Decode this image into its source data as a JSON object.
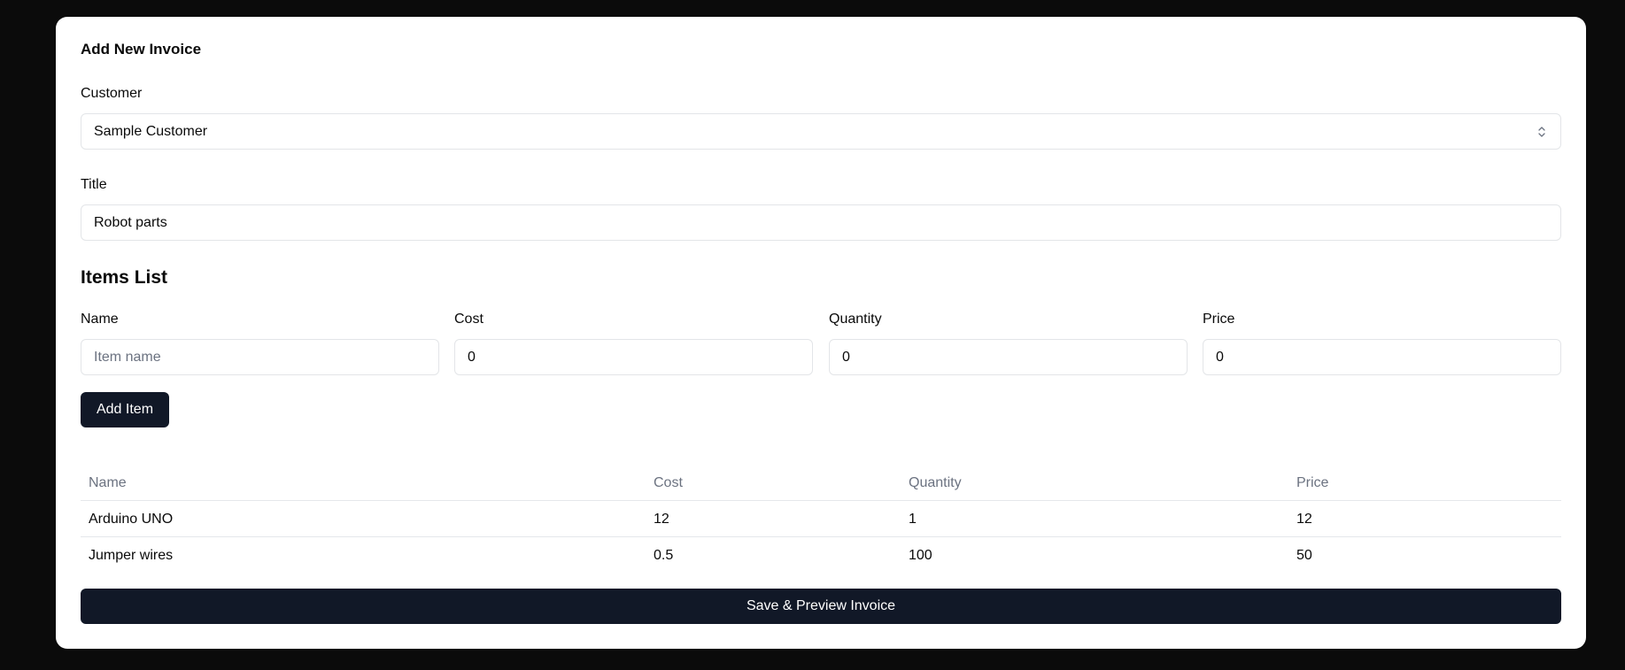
{
  "form": {
    "title": "Add New Invoice",
    "customer_label": "Customer",
    "customer_value": "Sample Customer",
    "title_label": "Title",
    "title_value": "Robot parts"
  },
  "items_section": {
    "title": "Items List",
    "name_label": "Name",
    "name_placeholder": "Item name",
    "cost_label": "Cost",
    "cost_value": "0",
    "quantity_label": "Quantity",
    "quantity_value": "0",
    "price_label": "Price",
    "price_value": "0",
    "add_button": "Add Item"
  },
  "table": {
    "headers": [
      "Name",
      "Cost",
      "Quantity",
      "Price"
    ],
    "rows": [
      [
        "Arduino UNO",
        "12",
        "1",
        "12"
      ],
      [
        "Jumper wires",
        "0.5",
        "100",
        "50"
      ]
    ]
  },
  "save_button": "Save & Preview Invoice",
  "icons": {
    "select": "chevron-up-down-icon"
  },
  "colors": {
    "background": "#0b0b0b",
    "card": "#ffffff",
    "primary_button": "#111827"
  }
}
